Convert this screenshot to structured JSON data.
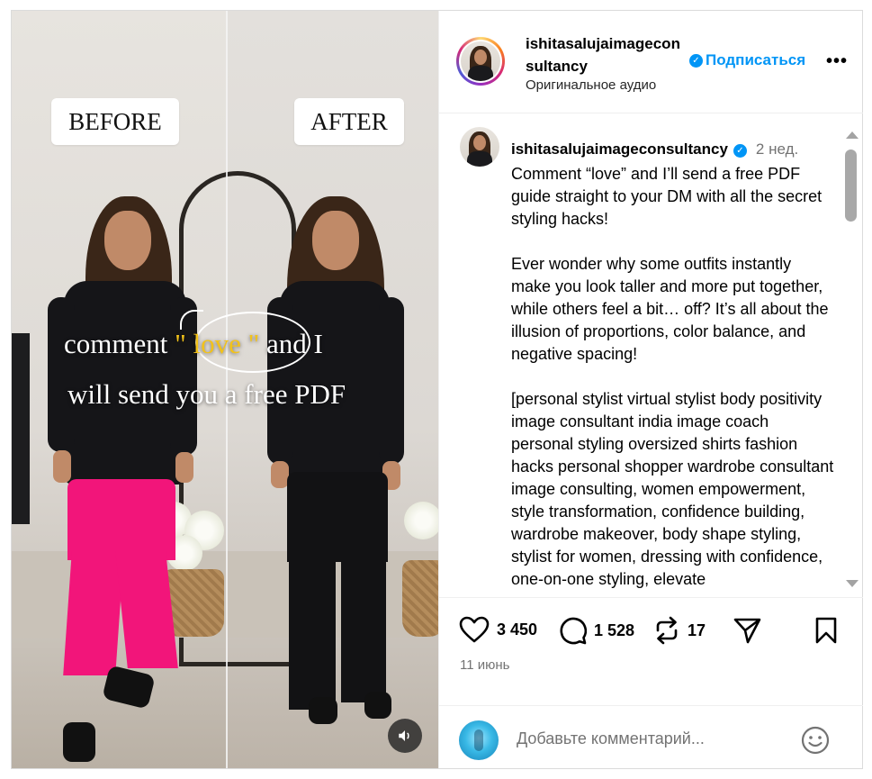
{
  "media": {
    "before_label": "BEFORE",
    "after_label": "AFTER",
    "overlay_line1_pre": "comment ",
    "overlay_line1_love": "\" love \"",
    "overlay_line1_post": " and I",
    "overlay_line2": "will send you a free PDF",
    "mute_icon": "speaker-icon"
  },
  "header": {
    "username": "ishitasalujaimageconsultancy",
    "audio": "Оригинальное аудио",
    "follow_label": "Подписаться",
    "more_label": "•••"
  },
  "caption": {
    "username": "ishitasalujaimageconsultancy",
    "time": "2 нед.",
    "text": "Comment “love” and I’ll send a free PDF guide straight to your DM with all the secret styling hacks!\n\nEver wonder why some outfits instantly make you look taller and more put together, while others feel a bit… off? It’s all about the illusion of proportions, color balance, and negative spacing!\n\n[personal stylist virtual stylist body positivity image consultant india image coach personal styling oversized shirts fashion hacks personal shopper wardrobe consultant image consulting, women empowerment, style transformation, confidence building, wardrobe makeover, body shape styling, stylist for women, dressing with confidence, one-on-one styling, elevate"
  },
  "actions": {
    "likes": "3 450",
    "comments": "1 528",
    "reposts": "17",
    "date": "11 июнь"
  },
  "comment_box": {
    "placeholder": "Добавьте комментарий..."
  },
  "colors": {
    "accent": "#0095f6",
    "love_text": "#f2c21a",
    "pink_pants": "#f2157a"
  }
}
